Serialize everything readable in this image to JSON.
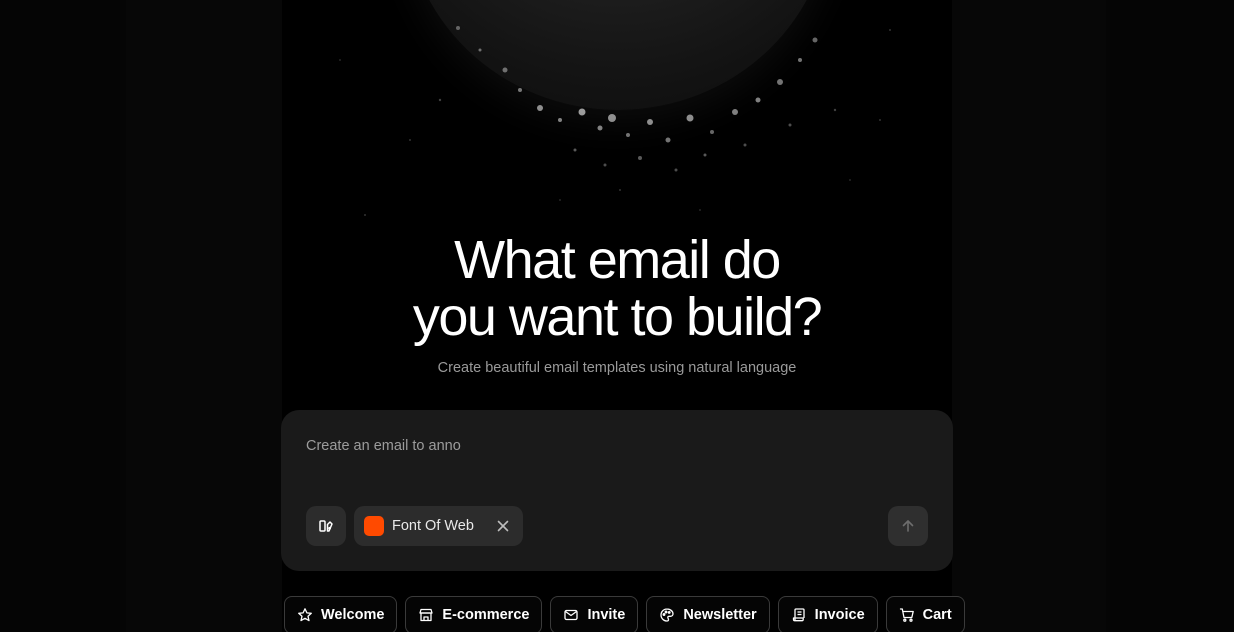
{
  "hero": {
    "title_line1": "What email do",
    "title_line2": "you want to build?",
    "subtitle": "Create beautiful email templates using natural language"
  },
  "prompt": {
    "value": "Create an email to anno",
    "placeholder": "Create an email to anno"
  },
  "brand_chip": {
    "label": "Font Of Web",
    "swatch_color": "#ff4a00"
  },
  "icons": {
    "template": "layout-template-icon",
    "close": "close-icon",
    "send": "arrow-up-icon"
  },
  "suggestions": [
    {
      "label": "Welcome",
      "icon": "star-icon"
    },
    {
      "label": "E-commerce",
      "icon": "store-icon"
    },
    {
      "label": "Invite",
      "icon": "mail-icon"
    },
    {
      "label": "Newsletter",
      "icon": "palette-icon"
    },
    {
      "label": "Invoice",
      "icon": "receipt-icon"
    },
    {
      "label": "Cart",
      "icon": "cart-icon"
    }
  ]
}
